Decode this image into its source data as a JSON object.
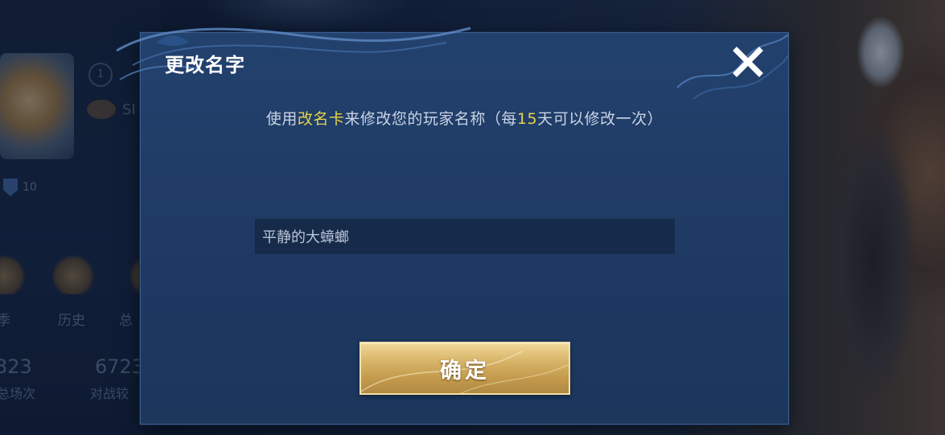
{
  "background": {
    "badge_number": "1",
    "player_initial": "SI",
    "level": "10",
    "stats": [
      {
        "label": "季",
        "value": "323",
        "sub": "总场次"
      },
      {
        "label": "历史",
        "value": "6723",
        "sub": "对战较"
      },
      {
        "label": "总",
        "value": "",
        "sub": ""
      }
    ]
  },
  "dialog": {
    "title": "更改名字",
    "close_icon": "close-icon",
    "instruction": {
      "prefix": "使用",
      "card_name": "改名卡",
      "middle": "来修改您的玩家名称（每",
      "days": "15",
      "suffix": "天可以修改一次）"
    },
    "name_field": {
      "value": "平静的大蟑螂",
      "placeholder": "平静的大蟑螂"
    },
    "confirm_label": "确定"
  },
  "colors": {
    "highlight": "#e6d34a",
    "dialog_bg": "#1f3b64",
    "button_gold": "#d8b569"
  }
}
